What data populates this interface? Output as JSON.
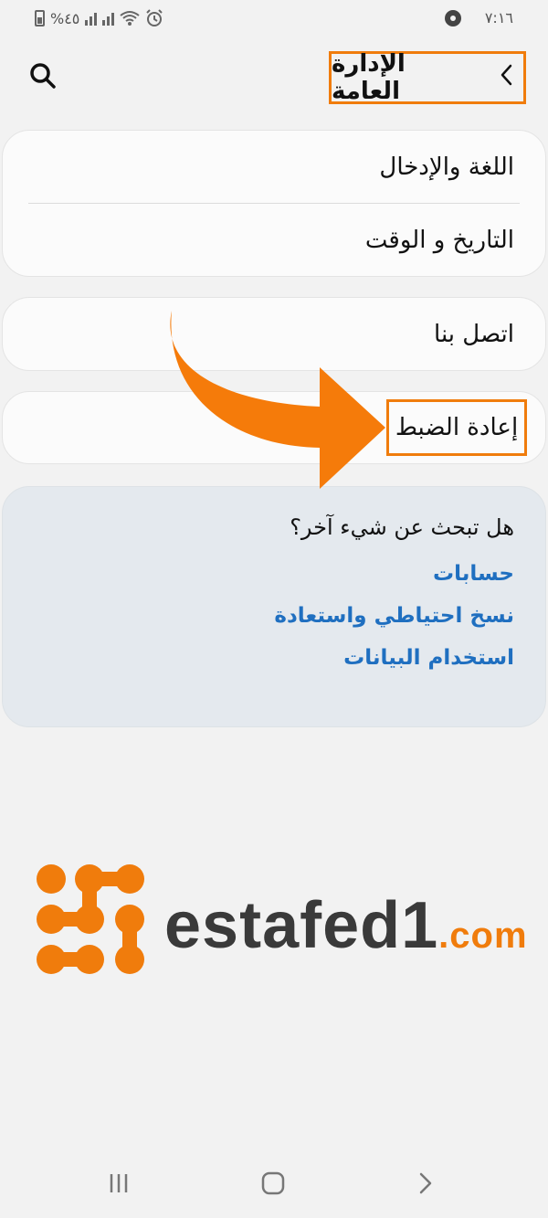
{
  "status_bar": {
    "time": "٧:١٦",
    "battery_text": "%٤٥"
  },
  "header": {
    "title": "الإدارة العامة"
  },
  "group1": {
    "items": [
      {
        "label": "اللغة والإدخال"
      },
      {
        "label": "التاريخ و الوقت"
      }
    ]
  },
  "group2": {
    "items": [
      {
        "label": "اتصل بنا"
      }
    ]
  },
  "group3": {
    "items": [
      {
        "label": "إعادة الضبط"
      }
    ]
  },
  "suggestions": {
    "heading": "هل تبحث عن شيء آخر؟",
    "links": [
      {
        "label": "حسابات"
      },
      {
        "label": "نسخ احتياطي واستعادة"
      },
      {
        "label": "استخدام البيانات"
      }
    ]
  },
  "watermark": {
    "brand": "estafed1",
    "domain": ".com"
  },
  "colors": {
    "highlight": "#f07c0c",
    "link": "#1f6fc0",
    "suggest_bg": "#e4e9ee",
    "card_bg": "#fbfbfb"
  }
}
